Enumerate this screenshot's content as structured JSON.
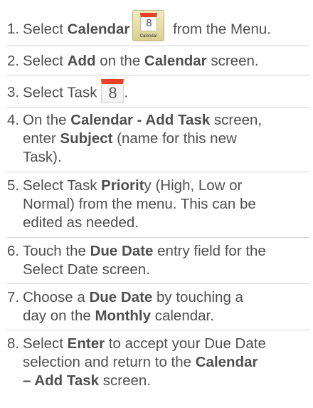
{
  "steps": [
    {
      "num": "1.",
      "t1": "Select ",
      "b1": "Calendar",
      "t2": " from the Menu.",
      "icon_caption": "Calendar",
      "icon_glyph": "8"
    },
    {
      "num": "2.",
      "t1": "Select ",
      "b1": "Add",
      "t2": " on the ",
      "b2": "Calendar",
      "t3": " screen."
    },
    {
      "num": "3.",
      "t1": "Select Task",
      "icon_glyph": "8",
      "t2": "."
    },
    {
      "num": "4.",
      "t1": "On the ",
      "b1": "Calendar - Add Task",
      "t2": " screen,",
      "l2a": "enter ",
      "l2b": "Subject",
      "l2c": " (name for this new",
      "l3": "Task)."
    },
    {
      "num": "5.",
      "t1": "Select Task ",
      "b1": "Priorit",
      "t2": "y (High, Low or",
      "l2": "Normal) from the menu. This can be",
      "l3": "edited as needed."
    },
    {
      "num": "6.",
      "t1": "Touch the ",
      "b1": "Due Date",
      "t2": " entry field for the",
      "l2": "Select Date screen."
    },
    {
      "num": "7.",
      "t1": "Choose a ",
      "b1": "Due Date",
      "t2": " by touching a",
      "l2a": "day on the ",
      "l2b": "Monthly",
      "l2c": " calendar."
    },
    {
      "num": "8.",
      "t1": "Select ",
      "b1": "Enter",
      "t2": " to accept your Due Date",
      "l2a": "selection and return to the ",
      "l2b": "Calendar",
      "l3a": "– Add Task",
      "l3b": " screen."
    }
  ]
}
